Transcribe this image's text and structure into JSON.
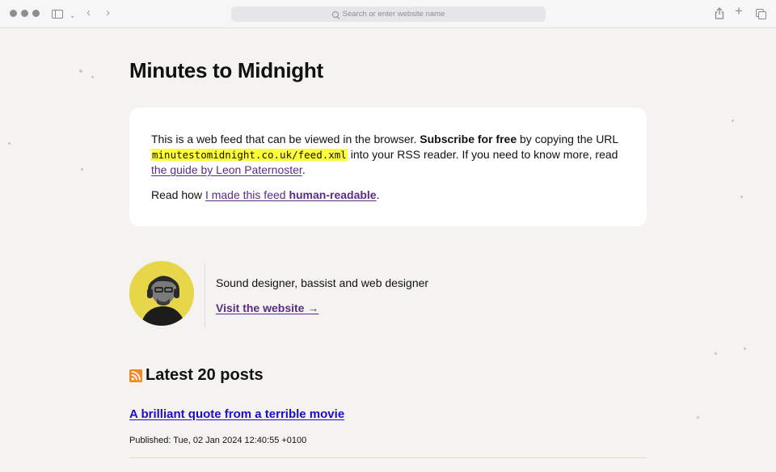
{
  "browser": {
    "url_placeholder": "Search or enter website name",
    "icons": [
      "sidebar-icon",
      "chevron-down-icon",
      "back-icon",
      "forward-icon",
      "search-icon",
      "share-icon",
      "plus-icon",
      "tabs-icon"
    ]
  },
  "page": {
    "title": "Minutes to Midnight"
  },
  "info_card": {
    "intro": "This is a web feed that can be viewed in the browser.",
    "subscribe_bold": "Subscribe for free",
    "by_copying": "by copying the URL",
    "feed_url": "minutestomidnight.co.uk/feed.xml",
    "into_reader": "into your RSS reader. If you need to know more, read",
    "guide_link": "the guide by Leon Paternoster",
    "period": ".",
    "read_how": "Read how",
    "made_link": "I made this feed",
    "made_link_bold": "human-readable",
    "period2": "."
  },
  "author": {
    "bio": "Sound designer, bassist and web designer",
    "website_link": "Visit the website →"
  },
  "posts": {
    "heading": "Latest 20 posts",
    "items": [
      {
        "title": "A brilliant quote from a terrible movie",
        "published": "Published: Tue, 02 Jan 2024 12:40:55 +0100"
      }
    ]
  },
  "colors": {
    "background": "#f4f3ef",
    "card": "#ffffff",
    "link_purple": "#5b2c83",
    "post_link": "#1a0dcf",
    "highlight": "#ffff3a",
    "rss_orange": "#f08a24",
    "avatar_bg": "#e8d64a"
  }
}
